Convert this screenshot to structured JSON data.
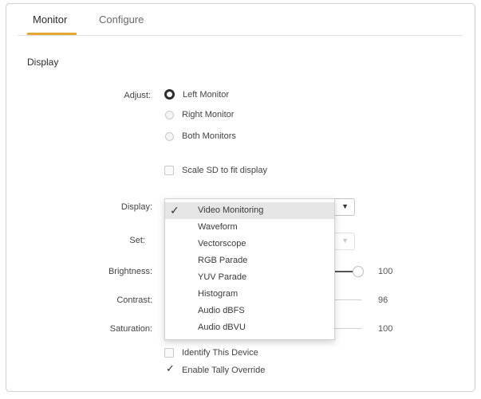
{
  "tabs": [
    {
      "label": "Monitor",
      "active": true
    },
    {
      "label": "Configure",
      "active": false
    }
  ],
  "accent_color": "#e7a534",
  "section": {
    "title": "Display"
  },
  "adjust": {
    "label": "Adjust:",
    "options": [
      "Left Monitor",
      "Right Monitor",
      "Both Monitors"
    ],
    "selected": "Left Monitor"
  },
  "scale_sd": {
    "label": "Scale SD to fit display",
    "checked": false
  },
  "display": {
    "label": "Display:",
    "selected": "Video Monitoring",
    "options": [
      "Video Monitoring",
      "Waveform",
      "Vectorscope",
      "RGB Parade",
      "YUV Parade",
      "Histogram",
      "Audio dBFS",
      "Audio dBVU"
    ],
    "check_glyph": "✓",
    "arrow_glyph": "▼"
  },
  "set": {
    "label": "Set:"
  },
  "brightness": {
    "label": "Brightness:",
    "value": "100"
  },
  "contrast": {
    "label": "Contrast:",
    "value": "96"
  },
  "saturation": {
    "label": "Saturation:",
    "value": "100"
  },
  "identify": {
    "label": "Identify This Device",
    "checked": false
  },
  "tally": {
    "label": "Enable Tally Override",
    "checked": true,
    "check_glyph": "✓"
  }
}
